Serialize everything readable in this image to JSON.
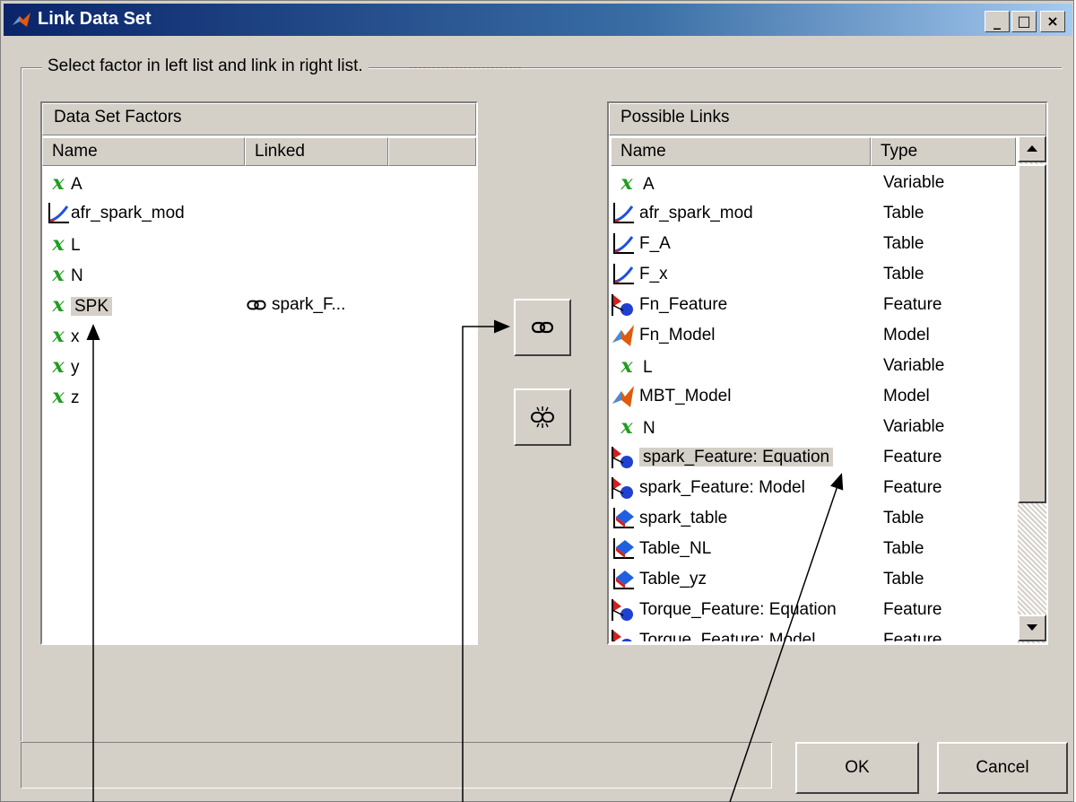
{
  "window": {
    "title": "Link Data Set",
    "minimize": "_",
    "maximize": "□",
    "close": "×"
  },
  "group": {
    "caption": "Select factor in left list and link in right list."
  },
  "left_panel": {
    "title": "Data Set Factors",
    "columns": [
      "Name",
      "Linked"
    ],
    "rows": [
      {
        "icon": "variable-icon",
        "name": "A",
        "linked": ""
      },
      {
        "icon": "table-icon",
        "name": "afr_spark_mod",
        "linked": ""
      },
      {
        "icon": "variable-icon",
        "name": "L",
        "linked": ""
      },
      {
        "icon": "variable-icon",
        "name": "N",
        "linked": ""
      },
      {
        "icon": "variable-icon",
        "name": "SPK",
        "linked": "spark_F...",
        "selected": true
      },
      {
        "icon": "variable-icon",
        "name": "x",
        "linked": ""
      },
      {
        "icon": "variable-icon",
        "name": "y",
        "linked": ""
      },
      {
        "icon": "variable-icon",
        "name": "z",
        "linked": ""
      }
    ]
  },
  "right_panel": {
    "title": "Possible Links",
    "columns": [
      "Name",
      "Type"
    ],
    "rows": [
      {
        "icon": "variable-icon",
        "name": "A",
        "type": "Variable"
      },
      {
        "icon": "table-icon",
        "name": "afr_spark_mod",
        "type": "Table"
      },
      {
        "icon": "table-icon",
        "name": "F_A",
        "type": "Table"
      },
      {
        "icon": "table-icon",
        "name": "F_x",
        "type": "Table"
      },
      {
        "icon": "feature-icon",
        "name": "Fn_Feature",
        "type": "Feature"
      },
      {
        "icon": "model-icon",
        "name": "Fn_Model",
        "type": "Model"
      },
      {
        "icon": "variable-icon",
        "name": "L",
        "type": "Variable"
      },
      {
        "icon": "model-icon",
        "name": "MBT_Model",
        "type": "Model"
      },
      {
        "icon": "variable-icon",
        "name": "N",
        "type": "Variable"
      },
      {
        "icon": "feature-icon",
        "name": "spark_Feature: Equation",
        "type": "Feature",
        "selected": true
      },
      {
        "icon": "feature-icon",
        "name": "spark_Feature: Model",
        "type": "Feature"
      },
      {
        "icon": "surface-table-icon",
        "name": "spark_table",
        "type": "Table"
      },
      {
        "icon": "surface-table-icon",
        "name": "Table_NL",
        "type": "Table"
      },
      {
        "icon": "surface-table-icon",
        "name": "Table_yz",
        "type": "Table"
      },
      {
        "icon": "feature-icon",
        "name": "Torque_Feature: Equation",
        "type": "Feature"
      },
      {
        "icon": "feature-icon",
        "name": "Torque_Feature: Model",
        "type": "Feature"
      }
    ]
  },
  "buttons": {
    "link": "link-icon",
    "unlink": "unlink-icon",
    "ok": "OK",
    "cancel": "Cancel"
  },
  "colors": {
    "title_start": "#0a246a",
    "title_end": "#a6caf0",
    "face": "#d4d0c8",
    "variable_green": "#1e9e1e"
  }
}
